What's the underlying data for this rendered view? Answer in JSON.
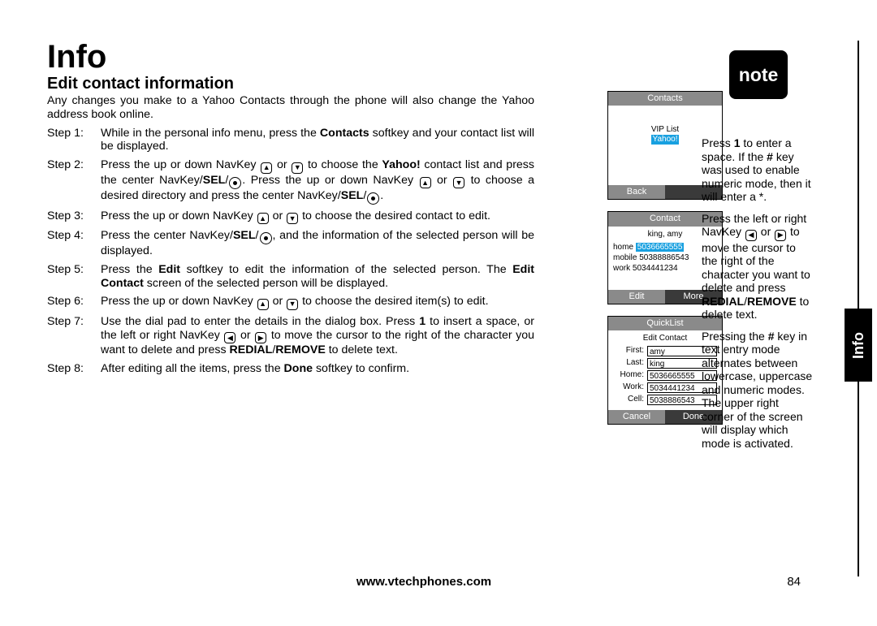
{
  "title": "Info",
  "subtitle": "Edit contact information",
  "intro": "Any changes you make to a Yahoo Contacts through the phone will also change the Yahoo address book online.",
  "steps": {
    "s1": {
      "label": "Step 1:",
      "a": "While in the personal info menu, press the ",
      "b": "Contacts",
      "c": " softkey and your contact list will be displayed."
    },
    "s2": {
      "label": "Step 2:",
      "a": "Press the up or down NavKey ",
      "b": " or ",
      "c": " to choose the ",
      "d": "Yahoo!",
      "e": " contact list and press the center NavKey/",
      "f": "SEL",
      "g": "/",
      "h": ". Press the up or down NavKey ",
      "i": " or ",
      "j": " to choose a desired directory and press the center NavKey/",
      "k": "SEL",
      "l": "/",
      "m": "."
    },
    "s3": {
      "label": "Step 3:",
      "a": "Press the up or down NavKey ",
      "b": " or ",
      "c": " to choose the desired contact to edit."
    },
    "s4": {
      "label": "Step 4:",
      "a": "Press the center NavKey/",
      "b": "SEL",
      "c": "/",
      "d": ", and the information of the selected person will be displayed."
    },
    "s5": {
      "label": "Step 5:",
      "a": "Press the ",
      "b": "Edit",
      "c": " softkey to edit the information of the selected person. The ",
      "d": "Edit Contact",
      "e": " screen of the selected person will be displayed."
    },
    "s6": {
      "label": "Step 6:",
      "a": "Press the up or down NavKey ",
      "b": " or ",
      "c": " to choose the desired item(s) to edit."
    },
    "s7": {
      "label": "Step 7:",
      "a": "Use the dial pad to enter the details in the dialog box. Press ",
      "b": "1",
      "c": " to insert a space, or the left or right NavKey ",
      "d": " or ",
      "e": " to move the cursor to the right of the character you want to delete and press ",
      "f": "REDIAL",
      "g": "/",
      "h": "REMOVE",
      "i": " to delete text."
    },
    "s8": {
      "label": "Step 8:",
      "a": "After editing all the items, press the ",
      "b": "Done",
      "c": " softkey to confirm."
    }
  },
  "screens": {
    "s1": {
      "title": "Contacts",
      "item1": "VIP List",
      "item2": "Yahoo!",
      "softkey_left": "Back"
    },
    "s2": {
      "title": "Contact",
      "name": "king, amy",
      "l1_lbl": "home",
      "l1_val": "5036665555",
      "l2_lbl": "mobile",
      "l2_val": "50388886543",
      "l3_lbl": "work",
      "l3_val": "5034441234",
      "softkey_left": "Edit",
      "softkey_right": "More"
    },
    "s3": {
      "title": "QuickList",
      "subtitle": "Edit Contact",
      "r1_lbl": "First:",
      "r1_val": "amy",
      "r2_lbl": "Last:",
      "r2_val": "king",
      "r3_lbl": "Home:",
      "r3_val": "5036665555",
      "r4_lbl": "Work:",
      "r4_val": "5034441234",
      "r5_lbl": "Cell:",
      "r5_val": "5038886543",
      "softkey_left": "Cancel",
      "softkey_right": "Done"
    }
  },
  "note": {
    "badge": "note",
    "p1a": "Press ",
    "p1b": "1",
    "p1c": " to enter a space. If the ",
    "p1d": "#",
    "p1e": " key was used to enable numeric mode, then it will enter a *.",
    "p2a": "Press the left or right NavKey ",
    "p2b": " or ",
    "p2c": " to move the cursor to the right of the character you want to delete and press ",
    "p2d": "REDIAL",
    "p2e": "/",
    "p2f": "REMOVE",
    "p2g": " to delete text.",
    "p3a": "Pressing the ",
    "p3b": "#",
    "p3c": " key in text entry mode alternates between lowercase, uppercase and numeric modes. The upper right corner of the screen will display which mode is activated."
  },
  "side_tab": "Info",
  "footer": {
    "url": "www.vtechphones.com",
    "page": "84"
  }
}
